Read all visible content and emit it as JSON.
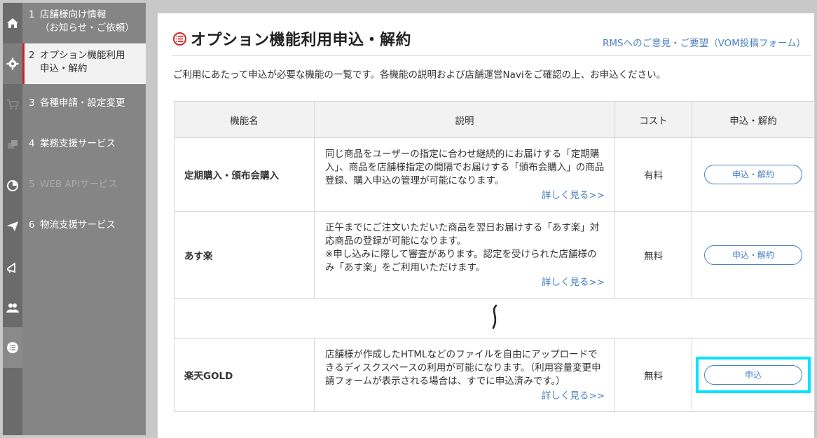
{
  "sidebar": {
    "items": [
      {
        "num": "1",
        "label": "店舗様向け情報（お知らせ・ご依頼）",
        "line1": "店舗様向け情報",
        "line2": "（お知らせ・ご依頼）",
        "icon": "home-icon"
      },
      {
        "num": "2",
        "label": "オプション機能利用申込・解約",
        "line1": "オプション機能利用",
        "line2": "申込・解約",
        "icon": "gear-icon",
        "active": true
      },
      {
        "num": "3",
        "label": "各種申請・設定変更",
        "icon": "cart-icon"
      },
      {
        "num": "4",
        "label": "業務支援サービス",
        "icon": "windows-icon"
      },
      {
        "num": "5",
        "label": "WEB APIサービス",
        "icon": "pie-chart-icon",
        "disabled": true
      },
      {
        "num": "6",
        "label": "物流支援サービス",
        "icon": "paper-plane-icon"
      }
    ],
    "extra_icons": [
      "megaphone-icon",
      "users-icon",
      "list-icon"
    ]
  },
  "header": {
    "title": "オプション機能利用申込・解約",
    "feedback_link": "RMSへのご意見・ご要望（VOM投稿フォーム）"
  },
  "intro": "ご利用にあたって申込が必要な機能の一覧です。各機能の説明および店舗運営Naviをご確認の上、お申込ください。",
  "table": {
    "headers": [
      "機能名",
      "説明",
      "コスト",
      "申込・解約"
    ],
    "rows": [
      {
        "name": "定期購入・頒布会購入",
        "desc": "同じ商品をユーザーの指定に合わせ継続的にお届けする「定期購入」、商品を店舗様指定の間隔でお届けする「頒布会購入」の商品登録、購入申込の管理が可能になります。",
        "more": "詳しく見る>>",
        "cost": "有料",
        "action": "申込・解約"
      },
      {
        "name": "あす楽",
        "desc": "正午までにご注文いただいた商品を翌日お届けする「あす楽」対応商品の登録が可能になります。",
        "desc2": "※申し込みに際して審査があります。認定を受けられた店舗様のみ「あす楽」をご利用いただけます。",
        "more": "詳しく見る>>",
        "cost": "無料",
        "action": "申込・解約"
      },
      {
        "name": "楽天GOLD",
        "desc": "店舗様が作成したHTMLなどのファイルを自由にアップロードできるディスクスペースの利用が可能になります。（利用容量変更申請フォームが表示される場合は、すでに申込済みです。）",
        "more": "詳しく見る>>",
        "cost": "無料",
        "action": "申込"
      }
    ]
  },
  "colors": {
    "accent": "#cc2222",
    "link": "#4a7fc1",
    "highlight": "#00e5ff"
  }
}
